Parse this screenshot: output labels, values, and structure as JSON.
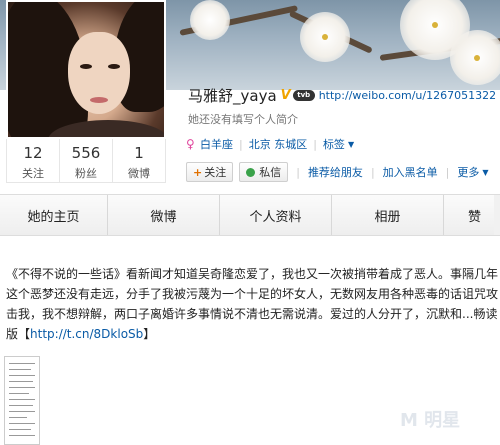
{
  "profile": {
    "name": "马雅舒_yaya",
    "verified_badge": "V",
    "media_badge": "tvb",
    "url": "http://weibo.com/u/1267051322",
    "bio": "她还没有填写个人简介",
    "gender_icon": "female-icon",
    "tags": {
      "horoscope": "白羊座",
      "location": "北京 东城区",
      "tag_label": "标签"
    }
  },
  "stats": [
    {
      "value": "12",
      "label": "关注"
    },
    {
      "value": "556",
      "label": "粉丝"
    },
    {
      "value": "1",
      "label": "微博"
    }
  ],
  "actions": {
    "follow": "关注",
    "message": "私信",
    "recommend": "推荐给朋友",
    "blacklist": "加入黑名单",
    "more": "更多"
  },
  "tabs": [
    "她的主页",
    "微博",
    "个人资料",
    "相册",
    "赞"
  ],
  "post": {
    "text": "《不得不说的一些话》看新闻才知道吴奇隆恋爱了，我也又一次被捎带着成了恶人。事隔几年这个恶梦还没有走远，分手了我被污蔑为一个十足的坏女人，无数网友用各种恶毒的话诅咒攻击我，我不想辩解，两口子离婚许多事情说不清也无需说清。爱过的人分开了，沉默和...畅读版【",
    "link": "http://t.cn/8DkloSb",
    "close": "】"
  },
  "colors": {
    "link": "#0a5ba6",
    "verified": "#f0a400",
    "gender": "#e0479e",
    "message_dot": "#3aa24a"
  }
}
